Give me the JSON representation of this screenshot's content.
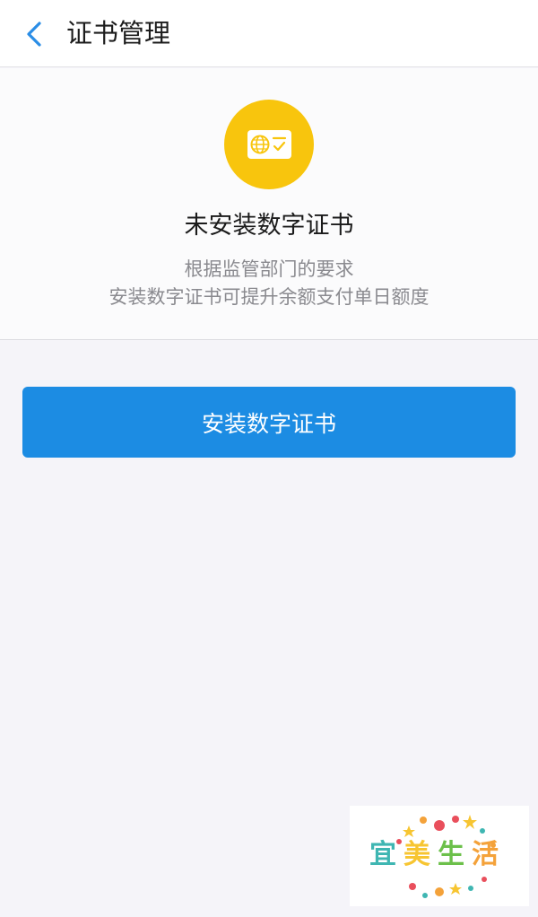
{
  "nav": {
    "back_icon": "chevron-left-icon",
    "title": "证书管理",
    "accent_color": "#2a8de6"
  },
  "status_card": {
    "icon": "certificate-globe-check-icon",
    "icon_color": "#f8c50d",
    "title": "未安装数字证书",
    "description_line1": "根据监管部门的要求",
    "description_line2": "安装数字证书可提升余额支付单日额度"
  },
  "install_button": {
    "label": "安装数字证书",
    "color": "#1c8ce3"
  },
  "watermark": {
    "chars": [
      "宜",
      "美",
      "生",
      "活"
    ]
  }
}
